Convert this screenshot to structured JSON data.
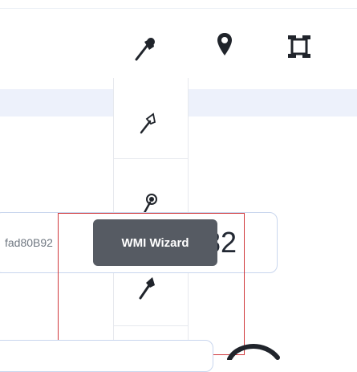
{
  "toolbar": {
    "icons": [
      "pin-icon",
      "location-marker-icon",
      "bounding-box-icon"
    ]
  },
  "tool_column": {
    "icons": [
      "pin-icon",
      "pin-icon",
      "pin-icon"
    ]
  },
  "id_field": {
    "value": "fad80B92",
    "number": "82"
  },
  "tooltip": {
    "label": "WMI Wizard"
  },
  "bottom": {
    "icons": [
      "circular-arc-icon"
    ]
  },
  "colors": {
    "accent_border": "#c9d6ee",
    "band": "#edf1fb",
    "selection": "#d0383c",
    "tooltip_bg": "#565b63"
  }
}
